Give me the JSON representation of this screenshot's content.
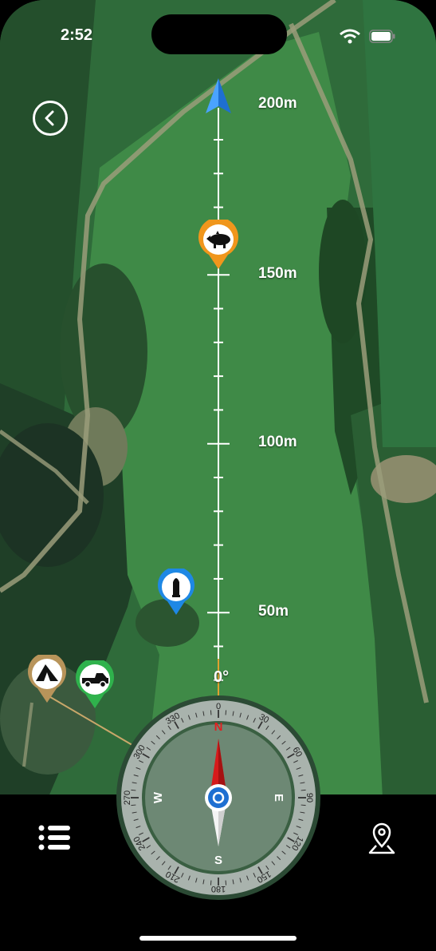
{
  "status_bar": {
    "time": "2:52"
  },
  "ruler": {
    "labels": [
      "200m",
      "150m",
      "100m",
      "50m"
    ],
    "heading": "0°"
  },
  "compass": {
    "outer_ticks": [
      "0",
      "30",
      "60",
      "90",
      "120",
      "150",
      "180",
      "210",
      "240",
      "270",
      "300",
      "330"
    ],
    "cardinals": {
      "n": "N",
      "e": "E",
      "s": "S",
      "w": "W"
    }
  },
  "markers": [
    {
      "name": "boar-marker",
      "icon": "boar-icon",
      "color": "#f0961c"
    },
    {
      "name": "ammo-marker",
      "icon": "bullet-icon",
      "color": "#1e88e5"
    },
    {
      "name": "tent-marker",
      "icon": "tent-icon",
      "color": "#b8945a"
    },
    {
      "name": "truck-marker",
      "icon": "truck-icon",
      "color": "#2fb24c"
    }
  ],
  "toolbar": {
    "left_icon": "list-icon",
    "right_icon": "location-pin-icon"
  }
}
